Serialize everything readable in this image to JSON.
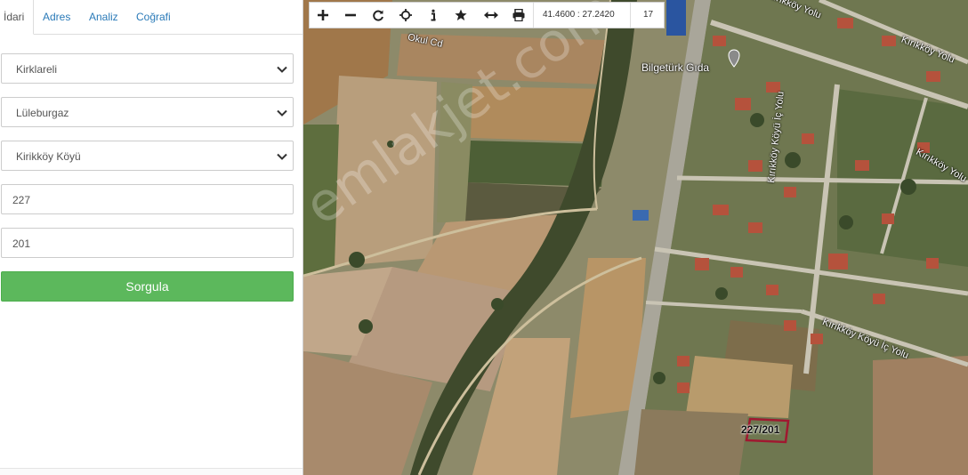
{
  "tabs": [
    {
      "label": "İdari",
      "active": true
    },
    {
      "label": "Adres",
      "active": false
    },
    {
      "label": "Analiz",
      "active": false
    },
    {
      "label": "Coğrafi",
      "active": false
    }
  ],
  "form": {
    "province": "Kirklareli",
    "district": "Lüleburgaz",
    "neighborhood": "Kirikköy Köyü",
    "block": "227",
    "parcel": "201",
    "submit_label": "Sorgula"
  },
  "toolbar": {
    "icons": [
      "zoom-in-icon",
      "zoom-out-icon",
      "refresh-icon",
      "locate-icon",
      "info-icon",
      "favorite-icon",
      "measure-icon",
      "print-icon"
    ],
    "coordinates": "41.4600 : 27.2420",
    "zoom_level": "17"
  },
  "map": {
    "labels": {
      "okul": "Okul Cd",
      "kirikkoy_top": "Kırıkköy Yolu",
      "kirikkoy_right": "Kırıkköy Yolu",
      "kirikkoy_right2": "Kırıkköy Yolu",
      "koyu_ic_vertical": "Kırıkköy Köyü İç Yolu",
      "koyu_ic_bottom": "Kırıkköy Köyü İç Yolu",
      "bilgeturk": "Bilgetürk Gıda",
      "watermark": "emlakjet.com"
    },
    "parcel_label": "227/201",
    "colors": {
      "parcel_outline": "#a01830",
      "submit_green": "#5cb85c",
      "tab_blue": "#2a7ab8"
    }
  }
}
